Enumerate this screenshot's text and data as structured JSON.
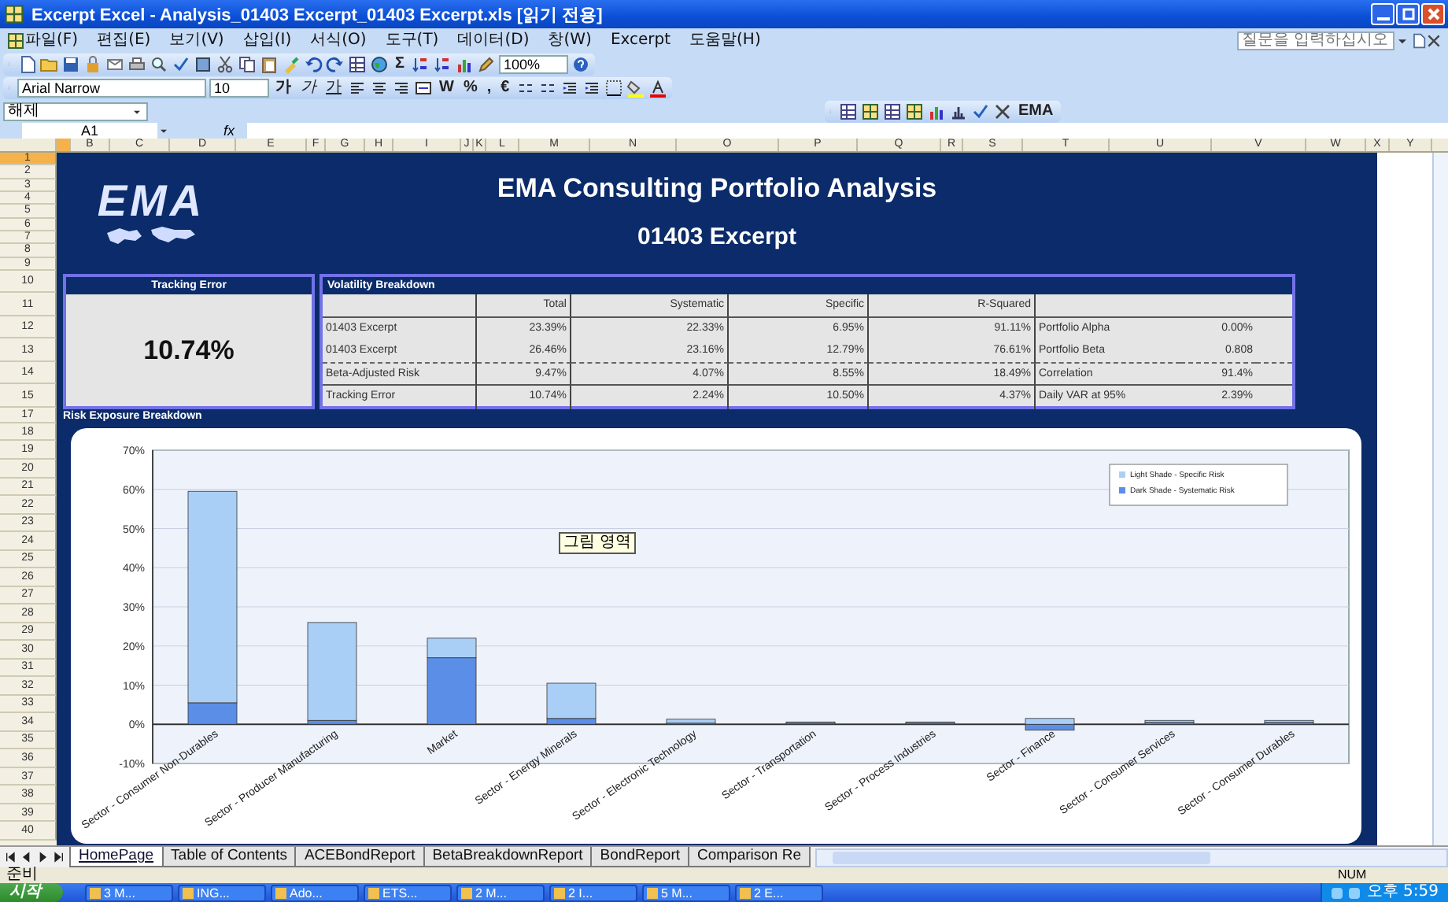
{
  "window": {
    "title": "Excerpt Excel - Analysis_01403 Excerpt_01403 Excerpt.xls  [읽기 전용]"
  },
  "menu": {
    "items": [
      "파일(F)",
      "편집(E)",
      "보기(V)",
      "삽입(I)",
      "서식(O)",
      "도구(T)",
      "데이터(D)",
      "창(W)",
      "Excerpt",
      "도움말(H)"
    ],
    "help_placeholder": "질문을 입력하십시오."
  },
  "standard_toolbar": {
    "sum_label": "Σ",
    "zoom": "100%"
  },
  "formatting_toolbar": {
    "font": "Arial Narrow",
    "size": "10",
    "style_buttons": [
      {
        "label": "가",
        "kind": "bold"
      },
      {
        "label": "가",
        "kind": "italic"
      },
      {
        "label": "가",
        "kind": "underline"
      }
    ],
    "symbol_buttons": [
      "W",
      "%",
      ",",
      "€"
    ]
  },
  "style_box": {
    "value": "해제"
  },
  "ema_toolbar": {
    "menu": "EMA"
  },
  "formula_bar": {
    "name_box": "A1",
    "function_label": "fx"
  },
  "column_headers": [
    "B",
    "C",
    "D",
    "E",
    "F",
    "G",
    "H",
    "I",
    "J",
    "K",
    "L",
    "M",
    "N",
    "O",
    "P",
    "Q",
    "R",
    "S",
    "T",
    "U",
    "V",
    "W",
    "X",
    "Y"
  ],
  "row_headers": [
    "1",
    "2",
    "3",
    "4",
    "5",
    "6",
    "7",
    "8",
    "9",
    "10",
    "11",
    "12",
    "13",
    "14",
    "15",
    "17",
    "18",
    "19",
    "20",
    "21",
    "22",
    "23",
    "24",
    "25",
    "26",
    "27",
    "28",
    "29",
    "30",
    "31",
    "32",
    "33",
    "34",
    "35",
    "36",
    "37",
    "38",
    "39",
    "40"
  ],
  "report": {
    "logo": "EMA",
    "title": "EMA Consulting Portfolio Analysis",
    "subtitle": "01403 Excerpt",
    "tracking_error": {
      "heading": "Tracking Error",
      "value": "10.74%"
    },
    "volatility": {
      "heading": "Volatility Breakdown",
      "columns": [
        "Total",
        "Systematic",
        "Specific",
        "R-Squared"
      ],
      "rows": [
        {
          "label": "01403 Excerpt",
          "values": [
            "23.39%",
            "22.33%",
            "6.95%",
            "91.11%"
          ],
          "stat_label": "Portfolio Alpha",
          "stat_value": "0.00%"
        },
        {
          "label": "01403 Excerpt",
          "values": [
            "26.46%",
            "23.16%",
            "12.79%",
            "76.61%"
          ],
          "stat_label": "Portfolio Beta",
          "stat_value": "0.808"
        },
        {
          "label": "Beta-Adjusted Risk",
          "values": [
            "9.47%",
            "4.07%",
            "8.55%",
            "18.49%"
          ],
          "stat_label": "Correlation",
          "stat_value": "91.4%"
        },
        {
          "label": "Tracking Error",
          "values": [
            "10.74%",
            "2.24%",
            "10.50%",
            "4.37%"
          ],
          "stat_label": "Daily VAR at 95%",
          "stat_value": "2.39%"
        }
      ]
    },
    "risk_exposure": {
      "heading": "Risk Exposure Breakdown",
      "tooltip": "그림 영역",
      "chart_data": {
        "type": "bar",
        "stacked": true,
        "categories": [
          "Sector - Consumer Non-Durables",
          "Sector - Producer Manufacturing",
          "Market",
          "Sector - Energy Minerals",
          "Sector - Electronic Technology",
          "Sector - Transportation",
          "Sector - Process Industries",
          "Sector - Finance",
          "Sector - Consumer Services",
          "Sector - Consumer Durables"
        ],
        "series": [
          {
            "name": "Dark Shade - Systematic Risk",
            "color": "#5b8ee6",
            "values": [
              5.5,
              1,
              17,
              1.5,
              0.3,
              0.3,
              0.3,
              -1.5,
              0.5,
              0.5
            ]
          },
          {
            "name": "Light Shade - Specific Risk",
            "color": "#aacff7",
            "values": [
              54,
              25,
              5,
              9,
              1,
              0.3,
              0.3,
              1.5,
              0.5,
              0.5
            ]
          }
        ],
        "grid": true,
        "legend": true,
        "ylim": [
          -10,
          70
        ],
        "yticks": [
          {
            "value": -10,
            "label": "-10%"
          },
          {
            "value": 0,
            "label": "0%"
          },
          {
            "value": 10,
            "label": "10%"
          },
          {
            "value": 20,
            "label": "20%"
          },
          {
            "value": 30,
            "label": "30%"
          },
          {
            "value": 40,
            "label": "40%"
          },
          {
            "value": 50,
            "label": "50%"
          },
          {
            "value": 60,
            "label": "60%"
          },
          {
            "value": 70,
            "label": "70%"
          }
        ]
      }
    }
  },
  "sheet_tabs": [
    {
      "label": "HomePage",
      "selected": true
    },
    {
      "label": "Table of Contents",
      "selected": false
    },
    {
      "label": "ACEBondReport",
      "selected": false
    },
    {
      "label": "BetaBreakdownReport",
      "selected": false
    },
    {
      "label": "BondReport",
      "selected": false
    },
    {
      "label": "Comparison Re",
      "selected": false
    }
  ],
  "status_bar": {
    "left": "준비",
    "right": "NUM"
  },
  "taskbar": {
    "start": "시작",
    "tasks": [
      "3 M...",
      "ING...",
      "Ado...",
      "ETS...",
      "2 M...",
      "2 I...",
      "5 M...",
      "2 E..."
    ],
    "clock": "오후 5:59"
  }
}
